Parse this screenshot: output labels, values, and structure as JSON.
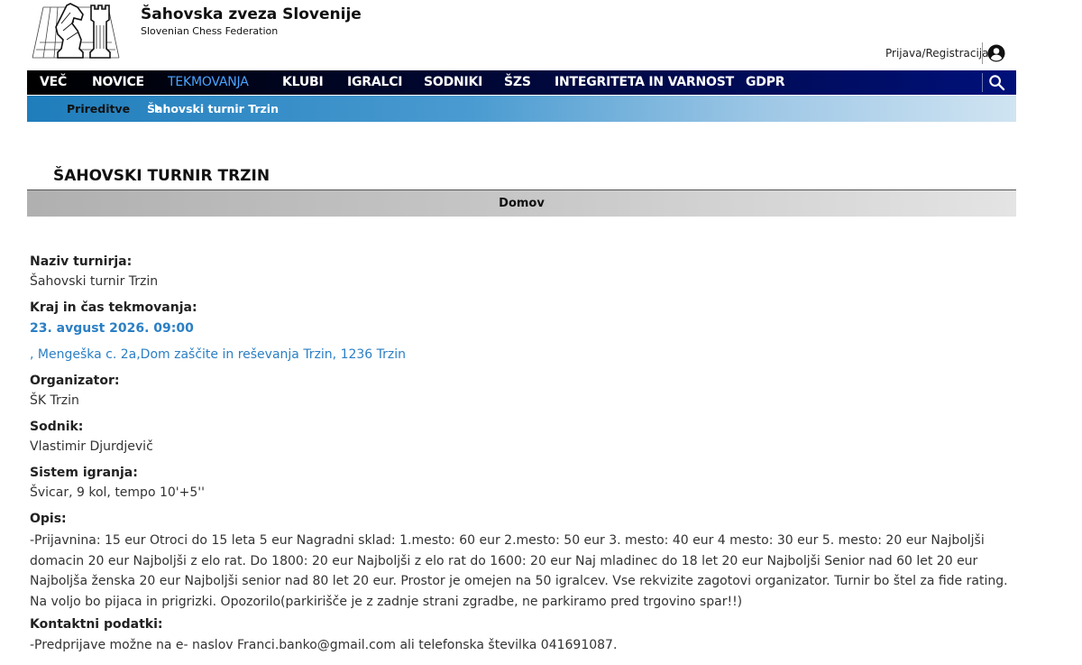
{
  "brand": {
    "title": "Šahovska zveza Slovenije",
    "subtitle": "Slovenian Chess Federation"
  },
  "header": {
    "login_label": "Prijava/Registracija",
    "user_icon": "user-circle-icon",
    "search_icon": "search-icon"
  },
  "nav": {
    "items": [
      "VEČ",
      "NOVICE",
      "TEKMOVANJA",
      "KLUBI",
      "IGRALCI",
      "SODNIKI",
      "ŠZS",
      "INTEGRITETA IN VARNOST",
      "GDPR"
    ],
    "active": "TEKMOVANJA",
    "active_color": "#4aa3ff"
  },
  "breadcrumb": {
    "parent": "Prireditve",
    "current": "Šahovski turnir Trzin"
  },
  "page": {
    "title": "ŠAHOVSKI TURNIR TRZIN",
    "home_label": "Domov"
  },
  "details": {
    "name_label": "Naziv turnirja:",
    "name_value": "Šahovski turnir Trzin",
    "place_label": "Kraj in čas tekmovanja:",
    "datetime": "23. avgust 2026. 09:00",
    "location": ", Mengeška c. 2a,Dom zaščite in reševanja Trzin, 1236 Trzin",
    "organizer_label": "Organizator:",
    "organizer_value": "ŠK Trzin",
    "judge_label": "Sodnik:",
    "judge_value": "Vlastimir Djurdjevič",
    "system_label": "Sistem igranja:",
    "system_value": "Švicar, 9 kol, tempo 10'+5''",
    "description_label": "Opis:",
    "description_value": "-Prijavnina: 15 eur Otroci do 15 leta 5 eur Nagradni sklad: 1.mesto: 60 eur 2.mesto: 50 eur 3. mesto: 40 eur 4 mesto: 30 eur 5. mesto: 20 eur Najboljši domacin 20 eur Najboljši z elo rat. Do 1800: 20 eur Najboljši z elo rat do 1600: 20 eur Naj mladinec do 18 let 20 eur Najboljši Senior nad 60 let 20 eur Najboljša ženska 20 eur Najboljši senior nad 80 let 20 eur. Prostor je omejen na 50 igralcev. Vse rekvizite zagotovi organizator. Turnir bo štel za fide rating. Na voljo bo pijaca in prigrizki. Opozorilo(parkirišče je z zadnje strani zgradbe, ne parkiramo pred trgovino spar!!)",
    "contact_label": "Kontaktni podatki:",
    "contact_value": "-Predprijave možne na e- naslov Franci.banko@gmail.com ali telefonska številka 041691087."
  },
  "colors": {
    "link_blue": "#2b7fc4",
    "nav_dark": "#000733",
    "subnav_blue": "#1f7dbb"
  }
}
